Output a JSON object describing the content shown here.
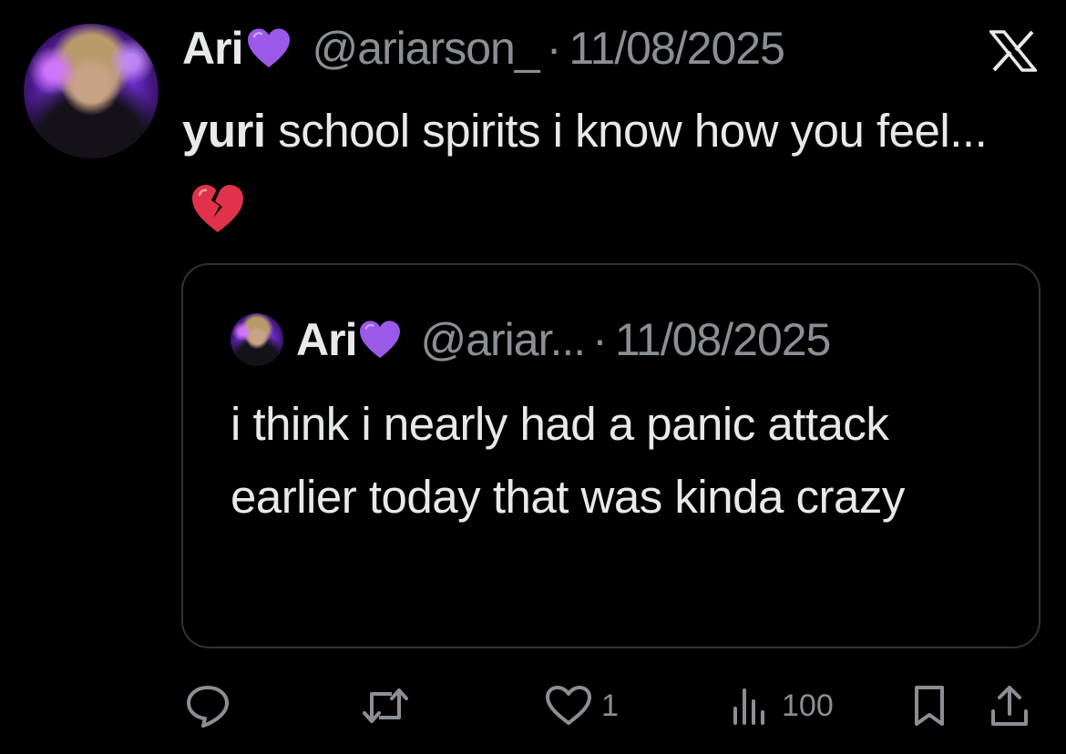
{
  "tweet": {
    "author_name": "Ari",
    "author_handle": "@ariarson_",
    "separator": "·",
    "date": "11/08/2025",
    "text_bold": "yuri",
    "text_rest": " school spirits i know how you feel...",
    "emoji_heart": "purple-heart",
    "emoji_text": "broken-heart"
  },
  "quoted": {
    "author_name": "Ari",
    "author_handle": "@ariar...",
    "separator": "·",
    "date": "11/08/2025",
    "text": "i think i nearly had a panic attack earlier today that was kinda crazy"
  },
  "actions": {
    "reply_count": "",
    "retweet_count": "",
    "like_count": "1",
    "views_count": "100"
  },
  "colors": {
    "background": "#000000",
    "text": "#e7e9ea",
    "muted": "#8b8f94",
    "border": "#2f3336",
    "purple_heart": "#9b59e8",
    "broken_heart": "#e0324a"
  }
}
